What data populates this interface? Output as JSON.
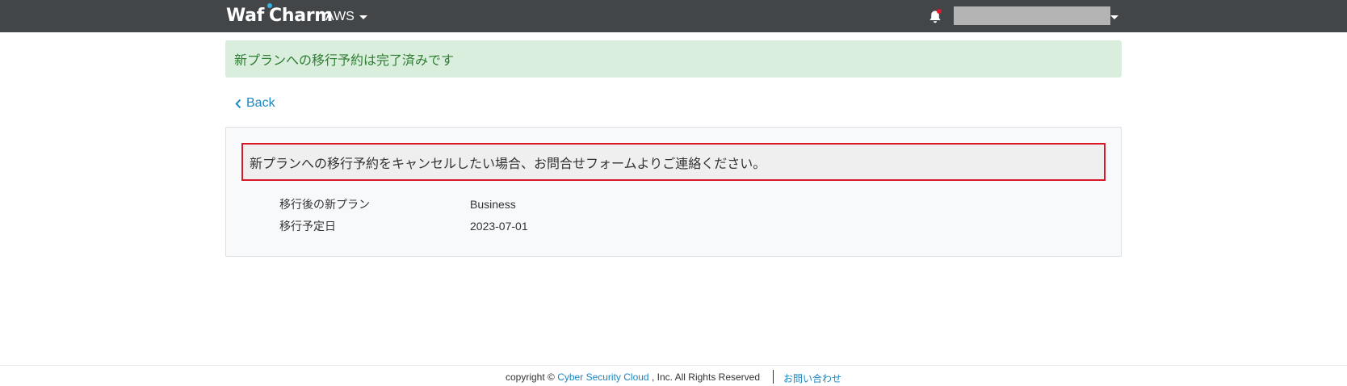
{
  "navbar": {
    "brand_part1": "Waf",
    "brand_part2": "Charm",
    "cloud_selector": "AWS",
    "notification_icon": "bell-icon",
    "account_name_redacted": true
  },
  "alert": {
    "message": "新プランへの移行予約は完了済みです"
  },
  "back_link": {
    "label": "Back",
    "icon": "chevron-left-icon"
  },
  "panel": {
    "notice": "新プランへの移行予約をキャンセルしたい場合、お問合せフォームよりご連絡ください。",
    "details": [
      {
        "label": "移行後の新プラン",
        "value": "Business"
      },
      {
        "label": "移行予定日",
        "value": "2023-07-01"
      }
    ]
  },
  "footer": {
    "copyright_prefix": "copyright ©",
    "company_link": "Cyber Security Cloud",
    "copyright_suffix": ", Inc. All Rights Reserved",
    "contact_link": "お問い合わせ"
  },
  "colors": {
    "navbar_bg": "#434648",
    "alert_bg": "#d9eedc",
    "alert_text": "#2e7d32",
    "link": "#1a87c2",
    "notice_border": "#d9192a",
    "notification_dot": "#e0192b",
    "brand_accent": "#37b0e4"
  }
}
